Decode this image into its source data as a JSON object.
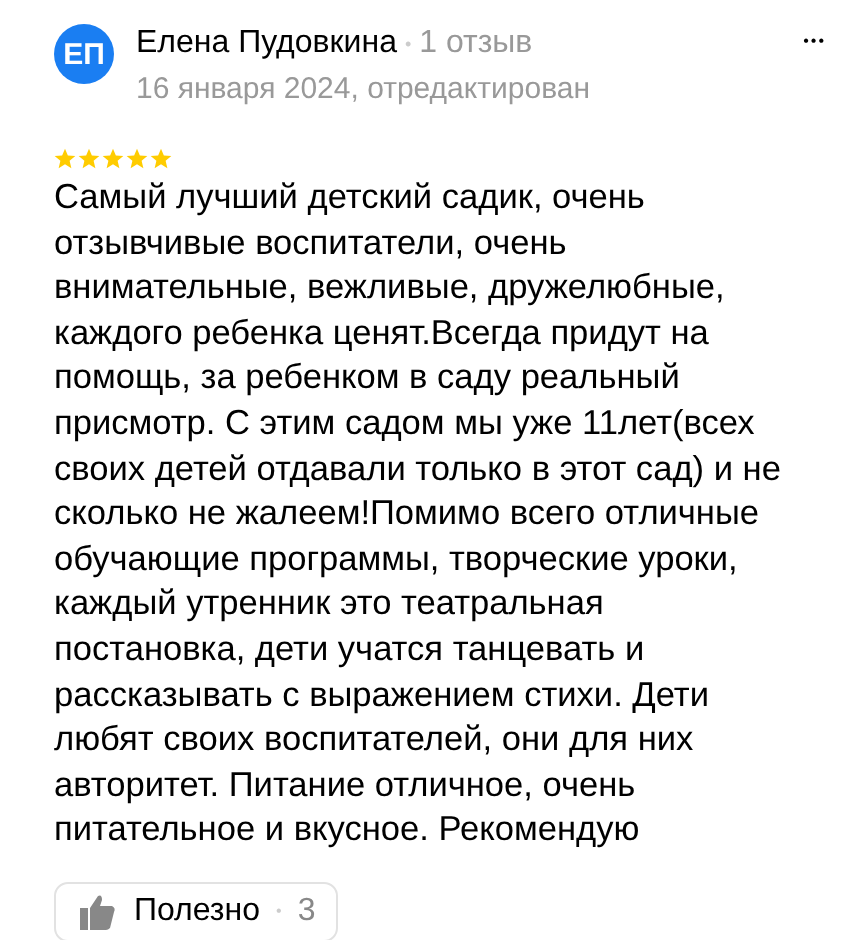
{
  "review": {
    "avatar_initials": "ЕП",
    "author": "Елена Пудовкина",
    "separator": "•",
    "review_count": "1 отзыв",
    "date": "16 января 2024, отредактирован",
    "more": "•••",
    "stars": 5,
    "text": "Самый лучший детский садик, очень отзывчивые воспитатели, очень внимательные, вежливые, дружелюбные, каждого ребенка ценят.Всегда придут на помощь, за ребенком в саду реальный присмотр. С этим садом мы уже 11лет(всех своих детей отдавали только в этот сад) и не сколько не жалеем!Помимо всего отличные обучающие программы, творческие уроки, каждый утренник это театральная постановка, дети учатся танцевать и рассказывать с выражением стихи. Дети любят своих воспитателей, они для них авторитет. Питание отличное, очень питательное и вкусное. Рекомендую",
    "helpful": {
      "label": "Полезно",
      "separator": "•",
      "count": "3"
    }
  }
}
